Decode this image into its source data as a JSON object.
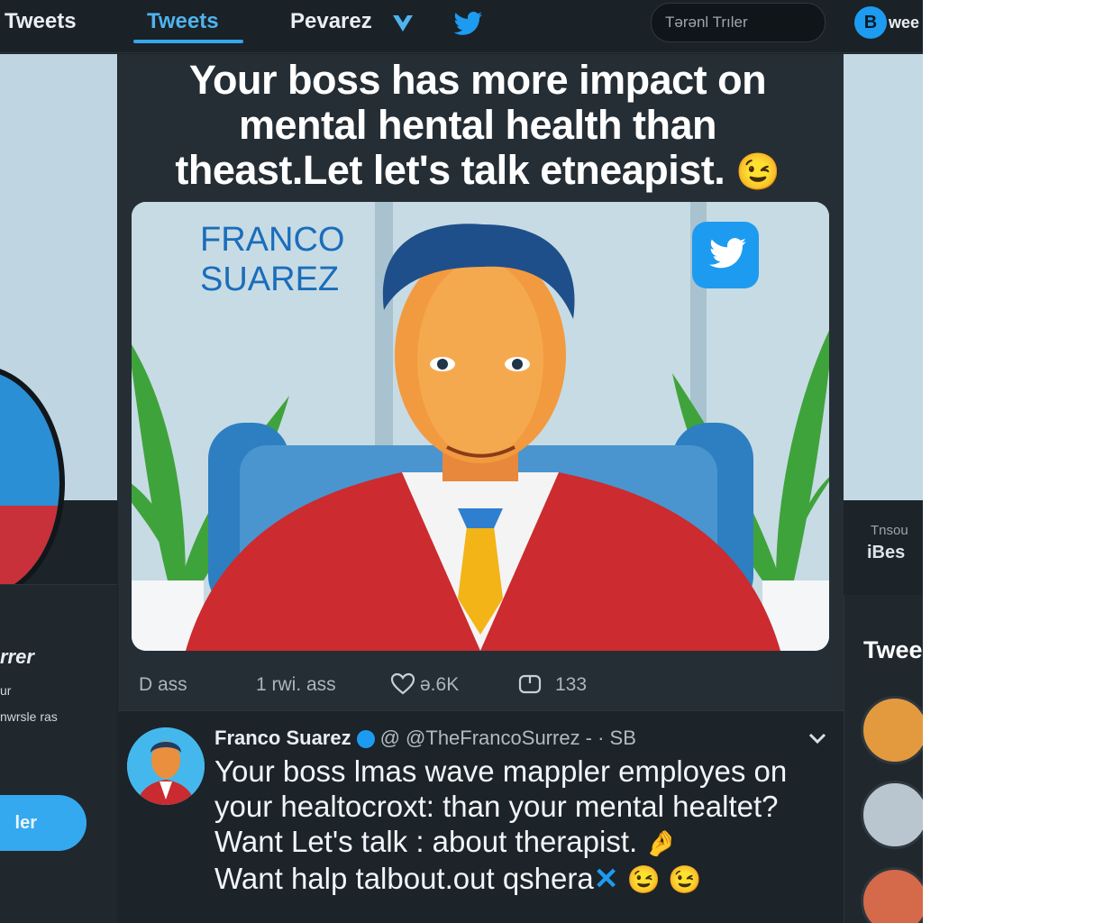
{
  "topbar": {
    "tabs": [
      "Tweets",
      "Tweets",
      "Pevarez"
    ],
    "search_placeholder": "Tərənl Trıler",
    "right_label": "wee"
  },
  "left": {
    "handle": "rrer",
    "line2": "ur",
    "line3": "nwrsle ras",
    "follow_label": "ler"
  },
  "main": {
    "headline": "Your boss has more  impact on  mental hental health than theast.Let let's talk  etneapist.",
    "headline_emoji": "😉",
    "media_name_line1": "FRANCO",
    "media_name_line2": "SUAREZ",
    "actions": {
      "replies": "D ass",
      "retweets": "1 rwi. ass",
      "likes": "ə.6K",
      "shares": "133"
    }
  },
  "reply": {
    "name": "Franco Suarez",
    "handle": "@ @TheFrancoSurrez - · SB",
    "body_lines": [
      "Your boss  lmas wave mappler employes on",
      "your healtocroxt: than your mental healtet?",
      "Want  Let's  talk : about therapist.",
      "Want halp talbout.out qshera"
    ],
    "body_emoji_line3": "🤌",
    "body_emoji_line4": "😉 😉"
  },
  "right": {
    "mini1": "Tnsou",
    "mini2": "iBes",
    "title": "Twee"
  },
  "colors": {
    "accent": "#1d9bf0",
    "background": "#1c2329",
    "card": "#262e35"
  }
}
